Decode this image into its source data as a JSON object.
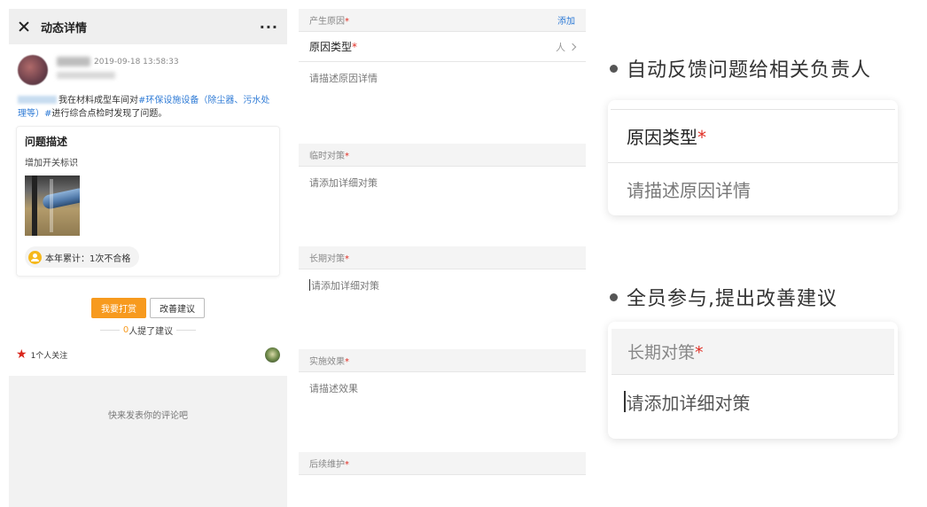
{
  "left": {
    "title": "动态详情",
    "more": "···",
    "post_time": "2019-09-18 13:58:33",
    "post_text_before": "我在材料成型车间对",
    "topic": "#环保设施设备（除尘器、污水处理等）#",
    "post_text_after": "进行综合点检时发现了问题。",
    "card_title": "问题描述",
    "card_desc": "增加开关标识",
    "annual_label": "本年累计：1次不合格",
    "reward_button": "我要打赏",
    "suggest_button": "改善建议",
    "suggest_count_num": "0",
    "suggest_count_text": "人提了建议",
    "follow_text": "1个人关注",
    "comment_placeholder": "快来发表你的评论吧"
  },
  "middle": {
    "cause_header": "产生原因",
    "add_link": "添加",
    "cause_type_label": "原因类型",
    "cause_type_value": "人",
    "cause_desc_placeholder": "请描述原因详情",
    "temp_header": "临时对策",
    "temp_placeholder": "请添加详细对策",
    "long_header": "长期对策",
    "long_placeholder": "请添加详细对策",
    "effect_header": "实施效果",
    "effect_placeholder": "请描述效果",
    "maintain_header": "后续维护",
    "required_mark": "*"
  },
  "right": {
    "bullet1": "自动反馈问题给相关负责人",
    "zoom1_cause_label": "原因类型",
    "zoom1_desc": "请描述原因详情",
    "bullet2": "全员参与,提出改善建议",
    "zoom2_header": "长期对策",
    "zoom2_input": "请添加详细对策",
    "required_mark": "*"
  },
  "colors": {
    "accent_orange": "#f79a1e",
    "link_blue": "#2f7bd6",
    "required_red": "#e02e24"
  }
}
